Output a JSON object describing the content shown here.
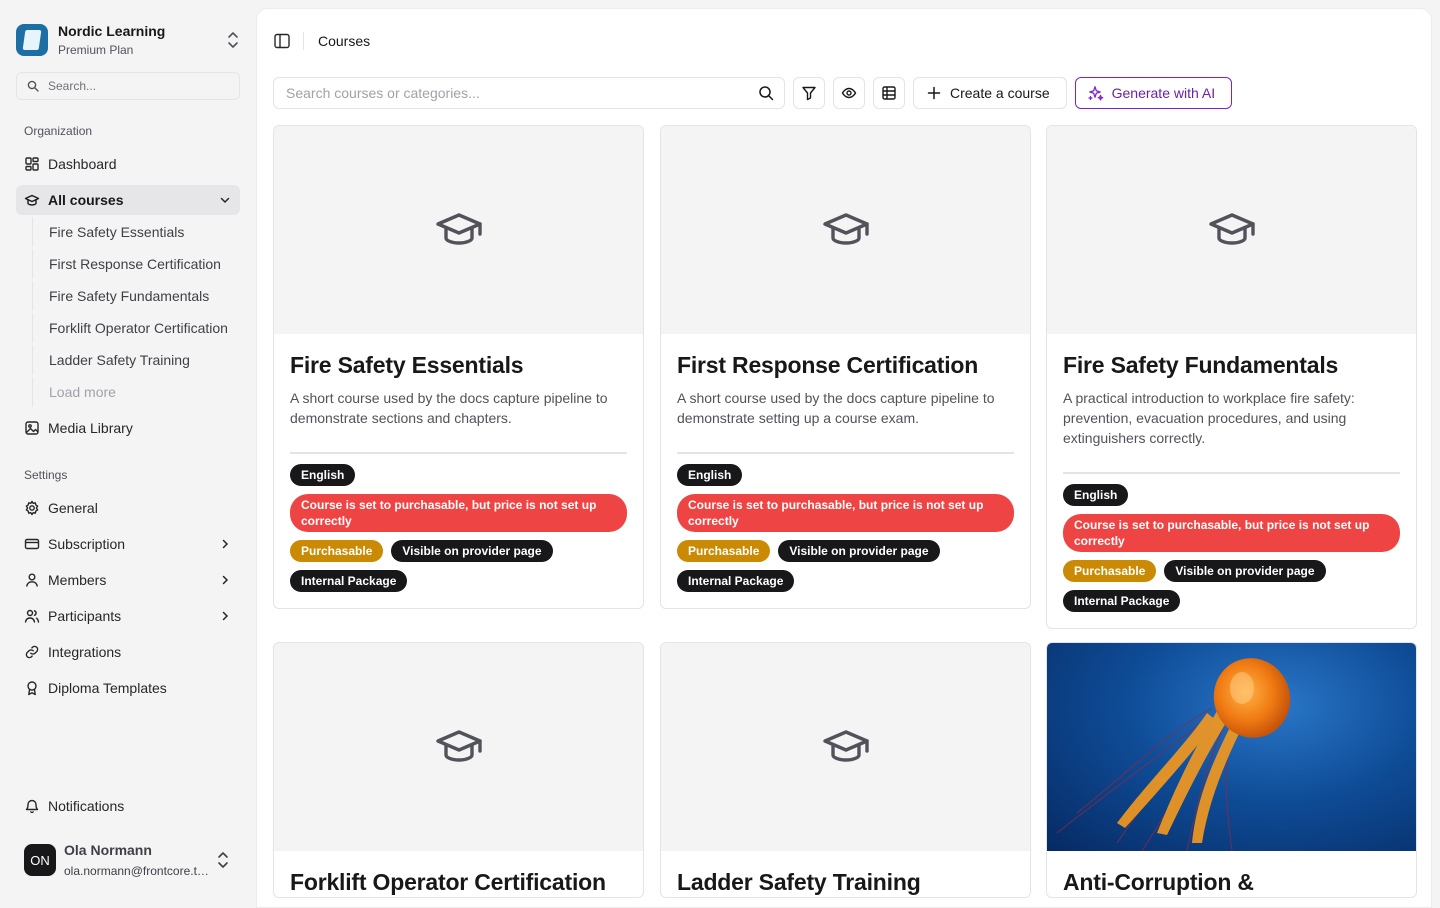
{
  "sidebar": {
    "org_name": "Nordic Learning",
    "org_plan": "Premium Plan",
    "search_placeholder": "Search...",
    "group_organization": "Organization",
    "dashboard": "Dashboard",
    "all_courses": "All courses",
    "course_links": [
      "Fire Safety Essentials",
      "First Response Certification",
      "Fire Safety Fundamentals",
      "Forklift Operator Certification",
      "Ladder Safety Training"
    ],
    "load_more": "Load more",
    "media_library": "Media Library",
    "group_settings": "Settings",
    "general": "General",
    "subscription": "Subscription",
    "members": "Members",
    "participants": "Participants",
    "integrations": "Integrations",
    "diploma_templates": "Diploma Templates",
    "notifications": "Notifications",
    "user": {
      "initials": "ON",
      "name": "Ola Normann",
      "email": "ola.normann@frontcore.tech"
    }
  },
  "header": {
    "breadcrumb": "Courses"
  },
  "toolbar": {
    "search_placeholder": "Search courses or categories...",
    "create_label": "Create a course",
    "ai_label": "Generate with AI",
    "ai_color": "#7e22ce"
  },
  "badges": {
    "language": "English",
    "warning": "Course is set to purchasable, but price is not set up correctly",
    "purchasable": "Purchasable",
    "visible": "Visible on provider page",
    "internal": "Internal Package"
  },
  "courses": [
    {
      "title": "Fire Safety Essentials",
      "description": "A short course used by the docs capture pipeline to demonstrate sections and chapters."
    },
    {
      "title": "First Response Certification",
      "description": "A short course used by the docs capture pipeline to demonstrate setting up a course exam."
    },
    {
      "title": "Fire Safety Fundamentals",
      "description": "A practical introduction to workplace fire safety: prevention, evacuation procedures, and using extinguishers correctly."
    },
    {
      "title": "Forklift Operator Certification"
    },
    {
      "title": "Ladder Safety Training"
    },
    {
      "title": "Anti-Corruption &"
    }
  ],
  "colors": {
    "warning_badge": "#ef4444",
    "purchasable_badge": "#ca8a04",
    "dark_badge": "#18181b"
  }
}
